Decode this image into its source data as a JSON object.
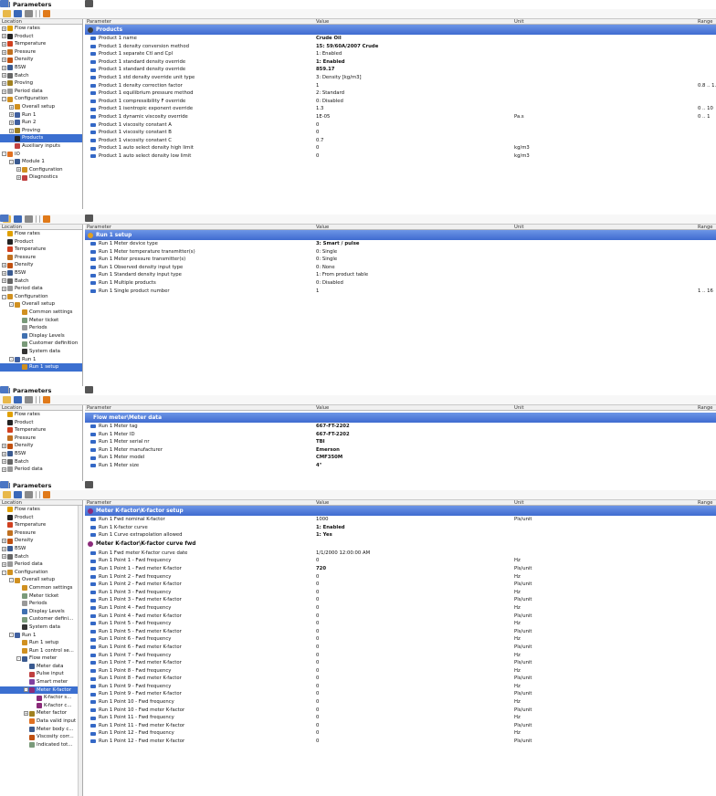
{
  "window_title": "Parameters",
  "columns": {
    "parameter": "Parameter",
    "value": "Value",
    "unit": "Unit",
    "range": "Range"
  },
  "tree_header": "Location",
  "panel1": {
    "section": "Products",
    "tree": [
      {
        "label": "Flow rates",
        "indent": 0,
        "exp": "+",
        "icon": "#e0a000"
      },
      {
        "label": "Product",
        "indent": 0,
        "exp": "+",
        "icon": "#222"
      },
      {
        "label": "Temperature",
        "indent": 0,
        "exp": "+",
        "icon": "#d04020"
      },
      {
        "label": "Pressure",
        "indent": 0,
        "exp": "+",
        "icon": "#c07020"
      },
      {
        "label": "Density",
        "indent": 0,
        "exp": "+",
        "icon": "#c05010"
      },
      {
        "label": "BSW",
        "indent": 0,
        "exp": "+",
        "icon": "#3a5a90"
      },
      {
        "label": "Batch",
        "indent": 0,
        "exp": "+",
        "icon": "#666"
      },
      {
        "label": "Proving",
        "indent": 0,
        "exp": "+",
        "icon": "#a08020"
      },
      {
        "label": "Period data",
        "indent": 0,
        "exp": "+",
        "icon": "#999"
      },
      {
        "label": "Configuration",
        "indent": 0,
        "exp": "-",
        "icon": "#d09020"
      },
      {
        "label": "Overall setup",
        "indent": 1,
        "exp": "+",
        "icon": "#d09020"
      },
      {
        "label": "Run 1",
        "indent": 1,
        "exp": "+",
        "icon": "#4060a0"
      },
      {
        "label": "Run 2",
        "indent": 1,
        "exp": "+",
        "icon": "#4060a0"
      },
      {
        "label": "Proving",
        "indent": 1,
        "exp": "+",
        "icon": "#a08020"
      },
      {
        "label": "Products",
        "indent": 1,
        "exp": "",
        "icon": "#222",
        "sel": true
      },
      {
        "label": "Auxiliary inputs",
        "indent": 1,
        "exp": "",
        "icon": "#c04040"
      },
      {
        "label": "IO",
        "indent": 0,
        "exp": "-",
        "icon": "#e07020"
      },
      {
        "label": "Module 1",
        "indent": 1,
        "exp": "-",
        "icon": "#3a5a90"
      },
      {
        "label": "Configuration",
        "indent": 2,
        "exp": "+",
        "icon": "#d09020"
      },
      {
        "label": "Diagnostics",
        "indent": 2,
        "exp": "+",
        "icon": "#c04040"
      }
    ],
    "rows": [
      {
        "p": "Product 1 name",
        "v": "Crude Oil",
        "u": "",
        "r": "",
        "b": true
      },
      {
        "p": "Product 1 density conversion method",
        "v": "15: 59/60A/2007 Crude",
        "u": "",
        "r": "",
        "b": true
      },
      {
        "p": "Product 1 separate Ctl and Cpl",
        "v": "1: Enabled",
        "u": "",
        "r": ""
      },
      {
        "p": "Product 1 standard density override",
        "v": "1: Enabled",
        "u": "",
        "r": "",
        "b": true
      },
      {
        "p": "Product 1 standard density override",
        "v": "859.17",
        "u": "",
        "r": "",
        "b": true
      },
      {
        "p": "Product 1 std density override unit type",
        "v": "3: Density [kg/m3]",
        "u": "",
        "r": ""
      },
      {
        "p": "Product 1 density correction factor",
        "v": "1",
        "u": "",
        "r": "0.8 .. 1.2"
      },
      {
        "p": "Product 1 equilibrium pressure method",
        "v": "2: Standard",
        "u": "",
        "r": ""
      },
      {
        "p": "Product 1 compressibility F override",
        "v": "0: Disabled",
        "u": "",
        "r": ""
      },
      {
        "p": "Product 1 isentropic exponent override",
        "v": "1.3",
        "u": "",
        "r": "0 .. 10"
      },
      {
        "p": "Product 1 dynamic viscosity override",
        "v": "1E-05",
        "u": "Pa.s",
        "r": "0 .. 1"
      },
      {
        "p": "Product 1 viscosity constant A",
        "v": "0",
        "u": "",
        "r": ""
      },
      {
        "p": "Product 1 viscosity constant B",
        "v": "0",
        "u": "",
        "r": ""
      },
      {
        "p": "Product 1 viscosity constant C",
        "v": "0.7",
        "u": "",
        "r": ""
      },
      {
        "p": "Product 1 auto select density high limit",
        "v": "0",
        "u": "kg/m3",
        "r": ""
      },
      {
        "p": "Product 1 auto select density low limit",
        "v": "0",
        "u": "kg/m3",
        "r": ""
      }
    ]
  },
  "panel2": {
    "section": "Run 1 setup",
    "tree": [
      {
        "label": "Flow rates",
        "indent": 0,
        "exp": "",
        "icon": "#e0a000"
      },
      {
        "label": "Product",
        "indent": 0,
        "exp": "",
        "icon": "#222"
      },
      {
        "label": "Temperature",
        "indent": 0,
        "exp": "",
        "icon": "#d04020"
      },
      {
        "label": "Pressure",
        "indent": 0,
        "exp": "",
        "icon": "#c07020"
      },
      {
        "label": "Density",
        "indent": 0,
        "exp": "+",
        "icon": "#c05010"
      },
      {
        "label": "BSW",
        "indent": 0,
        "exp": "+",
        "icon": "#3a5a90"
      },
      {
        "label": "Batch",
        "indent": 0,
        "exp": "+",
        "icon": "#666"
      },
      {
        "label": "Period data",
        "indent": 0,
        "exp": "+",
        "icon": "#999"
      },
      {
        "label": "Configuration",
        "indent": 0,
        "exp": "-",
        "icon": "#d09020"
      },
      {
        "label": "Overall setup",
        "indent": 1,
        "exp": "-",
        "icon": "#d09020"
      },
      {
        "label": "Common settings",
        "indent": 2,
        "exp": "",
        "icon": "#d09020"
      },
      {
        "label": "Meter ticket",
        "indent": 2,
        "exp": "",
        "icon": "#7a9a7a"
      },
      {
        "label": "Periods",
        "indent": 2,
        "exp": "",
        "icon": "#999"
      },
      {
        "label": "Display Levels",
        "indent": 2,
        "exp": "",
        "icon": "#4070b0"
      },
      {
        "label": "Customer definition",
        "indent": 2,
        "exp": "",
        "icon": "#7a9a7a"
      },
      {
        "label": "System data",
        "indent": 2,
        "exp": "",
        "icon": "#333"
      },
      {
        "label": "Run 1",
        "indent": 1,
        "exp": "-",
        "icon": "#4060a0"
      },
      {
        "label": "Run 1 setup",
        "indent": 2,
        "exp": "",
        "icon": "#d09020",
        "sel": true
      }
    ],
    "rows": [
      {
        "p": "Run 1 Meter device type",
        "v": "3: Smart / pulse",
        "u": "",
        "r": "",
        "b": true
      },
      {
        "p": "Run 1 Meter temperature transmitter(s)",
        "v": "0: Single",
        "u": "",
        "r": ""
      },
      {
        "p": "Run 1 Meter pressure transmitter(s)",
        "v": "0: Single",
        "u": "",
        "r": ""
      },
      {
        "p": "Run 1 Observed density input type",
        "v": "0: None",
        "u": "",
        "r": ""
      },
      {
        "p": "Run 1 Standard density input type",
        "v": "1: From product table",
        "u": "",
        "r": ""
      },
      {
        "p": "Run 1 Multiple products",
        "v": "0: Disabled",
        "u": "",
        "r": ""
      },
      {
        "p": "Run 1 Single product number",
        "v": "1",
        "u": "",
        "r": "1 .. 16"
      }
    ]
  },
  "panel3": {
    "section": "Flow meter\\Meter data",
    "tree": [
      {
        "label": "Flow rates",
        "indent": 0,
        "exp": "",
        "icon": "#e0a000"
      },
      {
        "label": "Product",
        "indent": 0,
        "exp": "",
        "icon": "#222"
      },
      {
        "label": "Temperature",
        "indent": 0,
        "exp": "",
        "icon": "#d04020"
      },
      {
        "label": "Pressure",
        "indent": 0,
        "exp": "",
        "icon": "#c07020"
      },
      {
        "label": "Density",
        "indent": 0,
        "exp": "+",
        "icon": "#c05010"
      },
      {
        "label": "BSW",
        "indent": 0,
        "exp": "+",
        "icon": "#3a5a90"
      },
      {
        "label": "Batch",
        "indent": 0,
        "exp": "+",
        "icon": "#666"
      },
      {
        "label": "Period data",
        "indent": 0,
        "exp": "+",
        "icon": "#999"
      }
    ],
    "rows": [
      {
        "p": "Run 1 Meter tag",
        "v": "667-FT-2202",
        "u": "",
        "r": "",
        "b": true
      },
      {
        "p": "Run 1 Meter ID",
        "v": "667-FT-2202",
        "u": "",
        "r": "",
        "b": true
      },
      {
        "p": "Run 1 Meter serial nr",
        "v": "TBI",
        "u": "",
        "r": "",
        "b": true
      },
      {
        "p": "Run 1 Meter manufacturer",
        "v": "Emerson",
        "u": "",
        "r": "",
        "b": true
      },
      {
        "p": "Run 1 Meter model",
        "v": "CMF350M",
        "u": "",
        "r": "",
        "b": true
      },
      {
        "p": "Run 1 Meter size",
        "v": "4\"",
        "u": "",
        "r": "",
        "b": true
      }
    ]
  },
  "panel4": {
    "section": "Meter K-factor\\K-factor setup",
    "section2": "Meter K-factor\\K-factor curve fwd",
    "tree": [
      {
        "label": "Flow rates",
        "indent": 0,
        "exp": "",
        "icon": "#e0a000"
      },
      {
        "label": "Product",
        "indent": 0,
        "exp": "",
        "icon": "#222"
      },
      {
        "label": "Temperature",
        "indent": 0,
        "exp": "",
        "icon": "#d04020"
      },
      {
        "label": "Pressure",
        "indent": 0,
        "exp": "",
        "icon": "#c07020"
      },
      {
        "label": "Density",
        "indent": 0,
        "exp": "+",
        "icon": "#c05010"
      },
      {
        "label": "BSW",
        "indent": 0,
        "exp": "+",
        "icon": "#3a5a90"
      },
      {
        "label": "Batch",
        "indent": 0,
        "exp": "+",
        "icon": "#666"
      },
      {
        "label": "Period data",
        "indent": 0,
        "exp": "+",
        "icon": "#999"
      },
      {
        "label": "Configuration",
        "indent": 0,
        "exp": "-",
        "icon": "#d09020"
      },
      {
        "label": "Overall setup",
        "indent": 1,
        "exp": "-",
        "icon": "#d09020"
      },
      {
        "label": "Common settings",
        "indent": 2,
        "exp": "",
        "icon": "#d09020"
      },
      {
        "label": "Meter ticket",
        "indent": 2,
        "exp": "",
        "icon": "#7a9a7a"
      },
      {
        "label": "Periods",
        "indent": 2,
        "exp": "",
        "icon": "#999"
      },
      {
        "label": "Display Levels",
        "indent": 2,
        "exp": "",
        "icon": "#4070b0"
      },
      {
        "label": "Customer defini...",
        "indent": 2,
        "exp": "",
        "icon": "#7a9a7a"
      },
      {
        "label": "System data",
        "indent": 2,
        "exp": "",
        "icon": "#333"
      },
      {
        "label": "Run 1",
        "indent": 1,
        "exp": "-",
        "icon": "#4060a0"
      },
      {
        "label": "Run 1 setup",
        "indent": 2,
        "exp": "",
        "icon": "#d09020"
      },
      {
        "label": "Run 1 control se...",
        "indent": 2,
        "exp": "",
        "icon": "#d09020"
      },
      {
        "label": "Flow meter",
        "indent": 2,
        "exp": "-",
        "icon": "#3a5a90"
      },
      {
        "label": "Meter data",
        "indent": 3,
        "exp": "",
        "icon": "#3a5a90"
      },
      {
        "label": "Pulse input",
        "indent": 3,
        "exp": "",
        "icon": "#c04040"
      },
      {
        "label": "Smart meter",
        "indent": 3,
        "exp": "",
        "icon": "#8040a0"
      },
      {
        "label": "Meter K-factor",
        "indent": 3,
        "exp": "-",
        "icon": "#8b2a7a",
        "sel": true
      },
      {
        "label": "K-factor s...",
        "indent": 4,
        "exp": "",
        "icon": "#8b2a7a"
      },
      {
        "label": "K-factor c...",
        "indent": 4,
        "exp": "",
        "icon": "#8b2a7a"
      },
      {
        "label": "Meter factor",
        "indent": 3,
        "exp": "+",
        "icon": "#a08020"
      },
      {
        "label": "Data valid input",
        "indent": 3,
        "exp": "",
        "icon": "#e07020"
      },
      {
        "label": "Meter body c...",
        "indent": 3,
        "exp": "",
        "icon": "#3a5a90"
      },
      {
        "label": "Viscosity corr...",
        "indent": 3,
        "exp": "",
        "icon": "#c05010"
      },
      {
        "label": "Indicated tot...",
        "indent": 3,
        "exp": "",
        "icon": "#7a9a7a"
      }
    ],
    "rows_setup": [
      {
        "p": "Run 1 Fwd nominal K-factor",
        "v": "1000",
        "u": "Pls/unit",
        "r": ""
      },
      {
        "p": "Run 1 K-factor curve",
        "v": "1: Enabled",
        "u": "",
        "r": "",
        "b": true
      },
      {
        "p": "Run 1 Curve extrapolation allowed",
        "v": "1: Yes",
        "u": "",
        "r": "",
        "b": true
      }
    ],
    "rows_curve": [
      {
        "p": "Run 1 Fwd meter K-factor curve date",
        "v": "1/1/2000 12:00:00 AM",
        "u": "",
        "r": ""
      },
      {
        "p": "Run 1 Point 1 - Fwd frequency",
        "v": "0",
        "u": "Hz",
        "r": ""
      },
      {
        "p": "Run 1 Point 1 - Fwd meter K-factor",
        "v": "720",
        "u": "Pls/unit",
        "r": "",
        "b": true
      },
      {
        "p": "Run 1 Point 2 - Fwd frequency",
        "v": "0",
        "u": "Hz",
        "r": ""
      },
      {
        "p": "Run 1 Point 2 - Fwd meter K-factor",
        "v": "0",
        "u": "Pls/unit",
        "r": ""
      },
      {
        "p": "Run 1 Point 3 - Fwd frequency",
        "v": "0",
        "u": "Hz",
        "r": ""
      },
      {
        "p": "Run 1 Point 3 - Fwd meter K-factor",
        "v": "0",
        "u": "Pls/unit",
        "r": ""
      },
      {
        "p": "Run 1 Point 4 - Fwd frequency",
        "v": "0",
        "u": "Hz",
        "r": ""
      },
      {
        "p": "Run 1 Point 4 - Fwd meter K-factor",
        "v": "0",
        "u": "Pls/unit",
        "r": ""
      },
      {
        "p": "Run 1 Point 5 - Fwd frequency",
        "v": "0",
        "u": "Hz",
        "r": ""
      },
      {
        "p": "Run 1 Point 5 - Fwd meter K-factor",
        "v": "0",
        "u": "Pls/unit",
        "r": ""
      },
      {
        "p": "Run 1 Point 6 - Fwd frequency",
        "v": "0",
        "u": "Hz",
        "r": ""
      },
      {
        "p": "Run 1 Point 6 - Fwd meter K-factor",
        "v": "0",
        "u": "Pls/unit",
        "r": ""
      },
      {
        "p": "Run 1 Point 7 - Fwd frequency",
        "v": "0",
        "u": "Hz",
        "r": ""
      },
      {
        "p": "Run 1 Point 7 - Fwd meter K-factor",
        "v": "0",
        "u": "Pls/unit",
        "r": ""
      },
      {
        "p": "Run 1 Point 8 - Fwd frequency",
        "v": "0",
        "u": "Hz",
        "r": ""
      },
      {
        "p": "Run 1 Point 8 - Fwd meter K-factor",
        "v": "0",
        "u": "Pls/unit",
        "r": ""
      },
      {
        "p": "Run 1 Point 9 - Fwd frequency",
        "v": "0",
        "u": "Hz",
        "r": ""
      },
      {
        "p": "Run 1 Point 9 - Fwd meter K-factor",
        "v": "0",
        "u": "Pls/unit",
        "r": ""
      },
      {
        "p": "Run 1 Point 10 - Fwd frequency",
        "v": "0",
        "u": "Hz",
        "r": ""
      },
      {
        "p": "Run 1 Point 10 - Fwd meter K-factor",
        "v": "0",
        "u": "Pls/unit",
        "r": ""
      },
      {
        "p": "Run 1 Point 11 - Fwd frequency",
        "v": "0",
        "u": "Hz",
        "r": ""
      },
      {
        "p": "Run 1 Point 11 - Fwd meter K-factor",
        "v": "0",
        "u": "Pls/unit",
        "r": ""
      },
      {
        "p": "Run 1 Point 12 - Fwd frequency",
        "v": "0",
        "u": "Hz",
        "r": ""
      },
      {
        "p": "Run 1 Point 12 - Fwd meter K-factor",
        "v": "0",
        "u": "Pls/unit",
        "r": ""
      }
    ]
  }
}
